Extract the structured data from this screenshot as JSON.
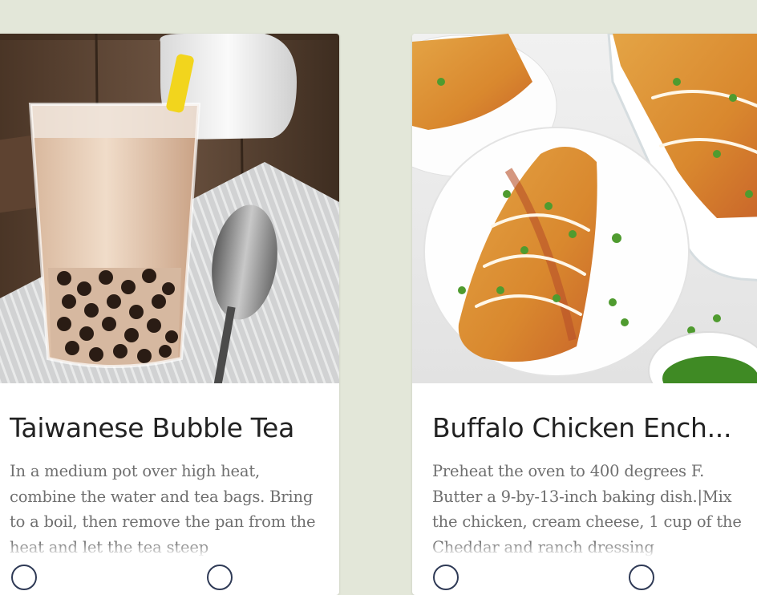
{
  "cards": [
    {
      "title": "Taiwanese Bubble Tea",
      "description": "In a medium pot over high heat, combine the water and tea bags. Bring to a boil, then remove the pan from the heat and let the tea steep",
      "actions": [
        "bookmark-icon",
        "share-icon"
      ]
    },
    {
      "title": "Buffalo Chicken Ench...",
      "description": "Preheat the oven to 400 degrees F. Butter a 9-by-13-inch baking dish.|Mix the chicken, cream cheese, 1 cup of the Cheddar and ranch dressing",
      "actions": [
        "bookmark-icon",
        "share-icon"
      ]
    }
  ],
  "colors": {
    "page_background": "#e3e7d9",
    "card_background": "#ffffff",
    "title_text": "#222222",
    "description_text": "#6f6f6f",
    "icon_outline": "#2f3a56"
  }
}
